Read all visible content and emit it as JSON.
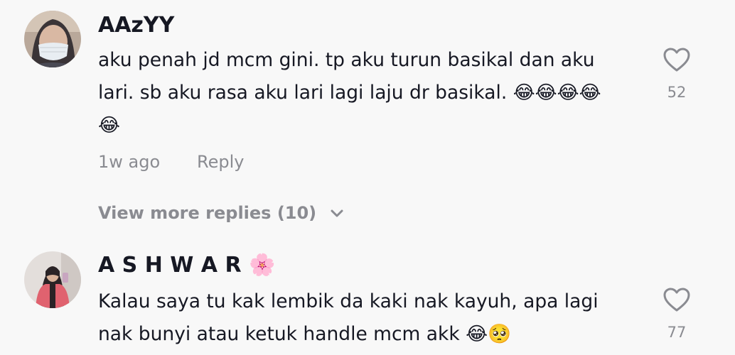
{
  "comments": [
    {
      "username": "AAzYY",
      "text": "aku penah jd mcm gini. tp aku turun basikal dan aku\nlari. sb aku rasa aku lari lagi laju dr basikal. 😂😂😂😂\n😂",
      "time": "1w ago",
      "reply_label": "Reply",
      "likes": "52",
      "view_more": "View more replies (10)"
    },
    {
      "username": "A S H W A R 🌸",
      "text": "Kalau saya tu kak lembik da kaki nak kayuh, apa lagi\nnak bunyi atau ketuk handle mcm akk 😂🥺",
      "likes": "77"
    }
  ],
  "icons": {
    "like": "heart-outline-icon",
    "expand": "chevron-down-icon"
  },
  "colors": {
    "background": "#f8f8f8",
    "text_primary": "#161823",
    "text_secondary": "#8a8b91"
  }
}
